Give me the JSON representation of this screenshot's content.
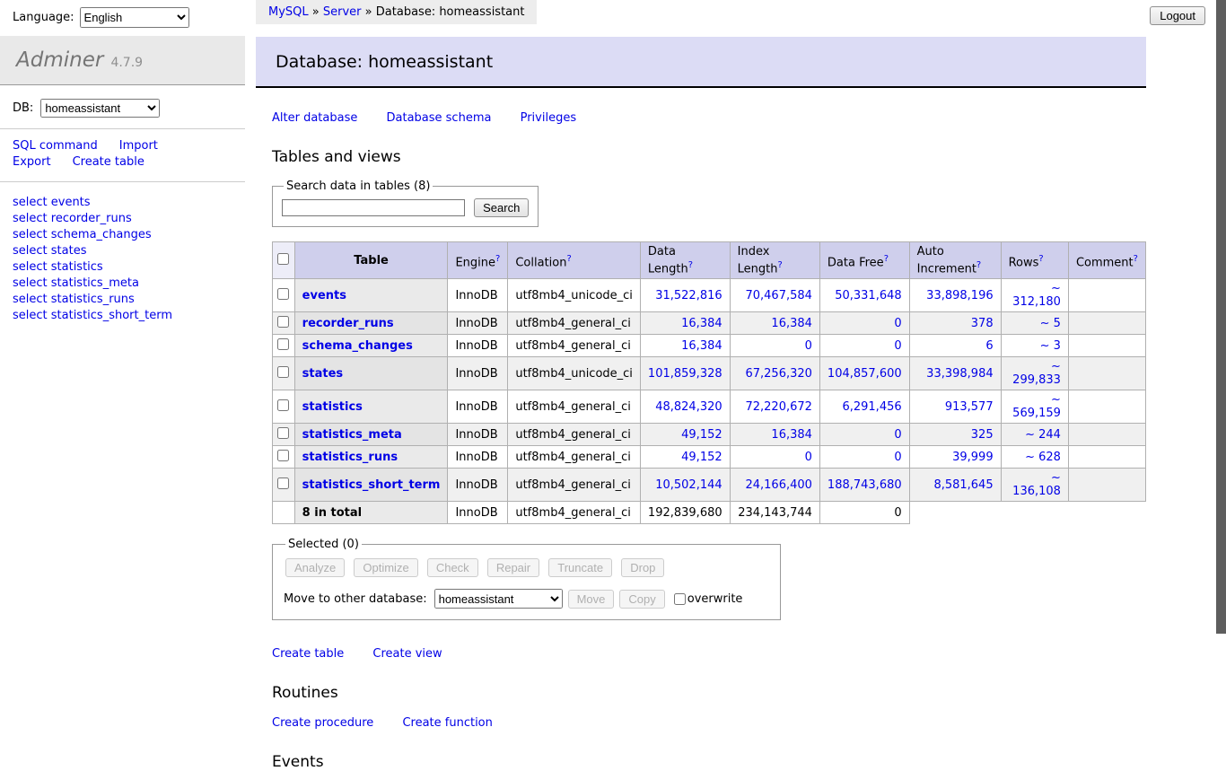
{
  "colors": {
    "link_blue": "#0000e6",
    "title_lavender": "#dcdcf5",
    "thead_lavender": "#cfcfec",
    "row_stripe_gray": "#f0f0f0",
    "th_gray": "#eaeaea",
    "breadcrumb_gray": "#ededed",
    "scrollbar_thumb": "#5e5e5e"
  },
  "topbar": {
    "language_label": "Language:",
    "language_value": "English",
    "logout_label": "Logout"
  },
  "breadcrumb": {
    "mysql": "MySQL",
    "server": "Server",
    "separator": "»",
    "current": "Database: homeassistant"
  },
  "sidebar": {
    "app_name": "Adminer",
    "app_version": "4.7.9",
    "db_label": "DB:",
    "db_value": "homeassistant",
    "links": [
      "SQL command",
      "Import",
      "Export",
      "Create table"
    ],
    "tables": [
      "select events",
      "select recorder_runs",
      "select schema_changes",
      "select states",
      "select statistics",
      "select statistics_meta",
      "select statistics_runs",
      "select statistics_short_term"
    ]
  },
  "main": {
    "title": "Database: homeassistant",
    "links": [
      "Alter database",
      "Database schema",
      "Privileges"
    ],
    "tables_heading": "Tables and views",
    "search": {
      "legend": "Search data in tables (8)",
      "button": "Search"
    },
    "table": {
      "qmark": "?",
      "headers": {
        "table": "Table",
        "engine": "Engine",
        "collation": "Collation",
        "data_length": "Data Length",
        "index_length": "Index Length",
        "data_free": "Data Free",
        "auto_increment": "Auto Increment",
        "rows": "Rows",
        "comment": "Comment"
      },
      "rows": [
        {
          "name": "events",
          "engine": "InnoDB",
          "collation": "utf8mb4_unicode_ci",
          "data_length": "31,522,816",
          "index_length": "70,467,584",
          "data_free": "50,331,648",
          "auto_increment": "33,898,196",
          "rows": "~ 312,180"
        },
        {
          "name": "recorder_runs",
          "engine": "InnoDB",
          "collation": "utf8mb4_general_ci",
          "data_length": "16,384",
          "index_length": "16,384",
          "data_free": "0",
          "auto_increment": "378",
          "rows": "~ 5"
        },
        {
          "name": "schema_changes",
          "engine": "InnoDB",
          "collation": "utf8mb4_general_ci",
          "data_length": "16,384",
          "index_length": "0",
          "data_free": "0",
          "auto_increment": "6",
          "rows": "~ 3"
        },
        {
          "name": "states",
          "engine": "InnoDB",
          "collation": "utf8mb4_unicode_ci",
          "data_length": "101,859,328",
          "index_length": "67,256,320",
          "data_free": "104,857,600",
          "auto_increment": "33,398,984",
          "rows": "~ 299,833"
        },
        {
          "name": "statistics",
          "engine": "InnoDB",
          "collation": "utf8mb4_general_ci",
          "data_length": "48,824,320",
          "index_length": "72,220,672",
          "data_free": "6,291,456",
          "auto_increment": "913,577",
          "rows": "~ 569,159"
        },
        {
          "name": "statistics_meta",
          "engine": "InnoDB",
          "collation": "utf8mb4_general_ci",
          "data_length": "49,152",
          "index_length": "16,384",
          "data_free": "0",
          "auto_increment": "325",
          "rows": "~ 244"
        },
        {
          "name": "statistics_runs",
          "engine": "InnoDB",
          "collation": "utf8mb4_general_ci",
          "data_length": "49,152",
          "index_length": "0",
          "data_free": "0",
          "auto_increment": "39,999",
          "rows": "~ 628"
        },
        {
          "name": "statistics_short_term",
          "engine": "InnoDB",
          "collation": "utf8mb4_general_ci",
          "data_length": "10,502,144",
          "index_length": "24,166,400",
          "data_free": "188,743,680",
          "auto_increment": "8,581,645",
          "rows": "~ 136,108"
        }
      ],
      "total": {
        "label": "8 in total",
        "engine": "InnoDB",
        "collation": "utf8mb4_general_ci",
        "data_length": "192,839,680",
        "index_length": "234,143,744",
        "data_free": "0"
      }
    },
    "selected": {
      "legend": "Selected (0)",
      "buttons": [
        "Analyze",
        "Optimize",
        "Check",
        "Repair",
        "Truncate",
        "Drop"
      ],
      "move_label": "Move to other database:",
      "move_db": "homeassistant",
      "move_button": "Move",
      "copy_button": "Copy",
      "overwrite_label": "overwrite"
    },
    "bottom_links": [
      "Create table",
      "Create view"
    ],
    "routines_heading": "Routines",
    "routine_links": [
      "Create procedure",
      "Create function"
    ],
    "events_heading": "Events"
  }
}
